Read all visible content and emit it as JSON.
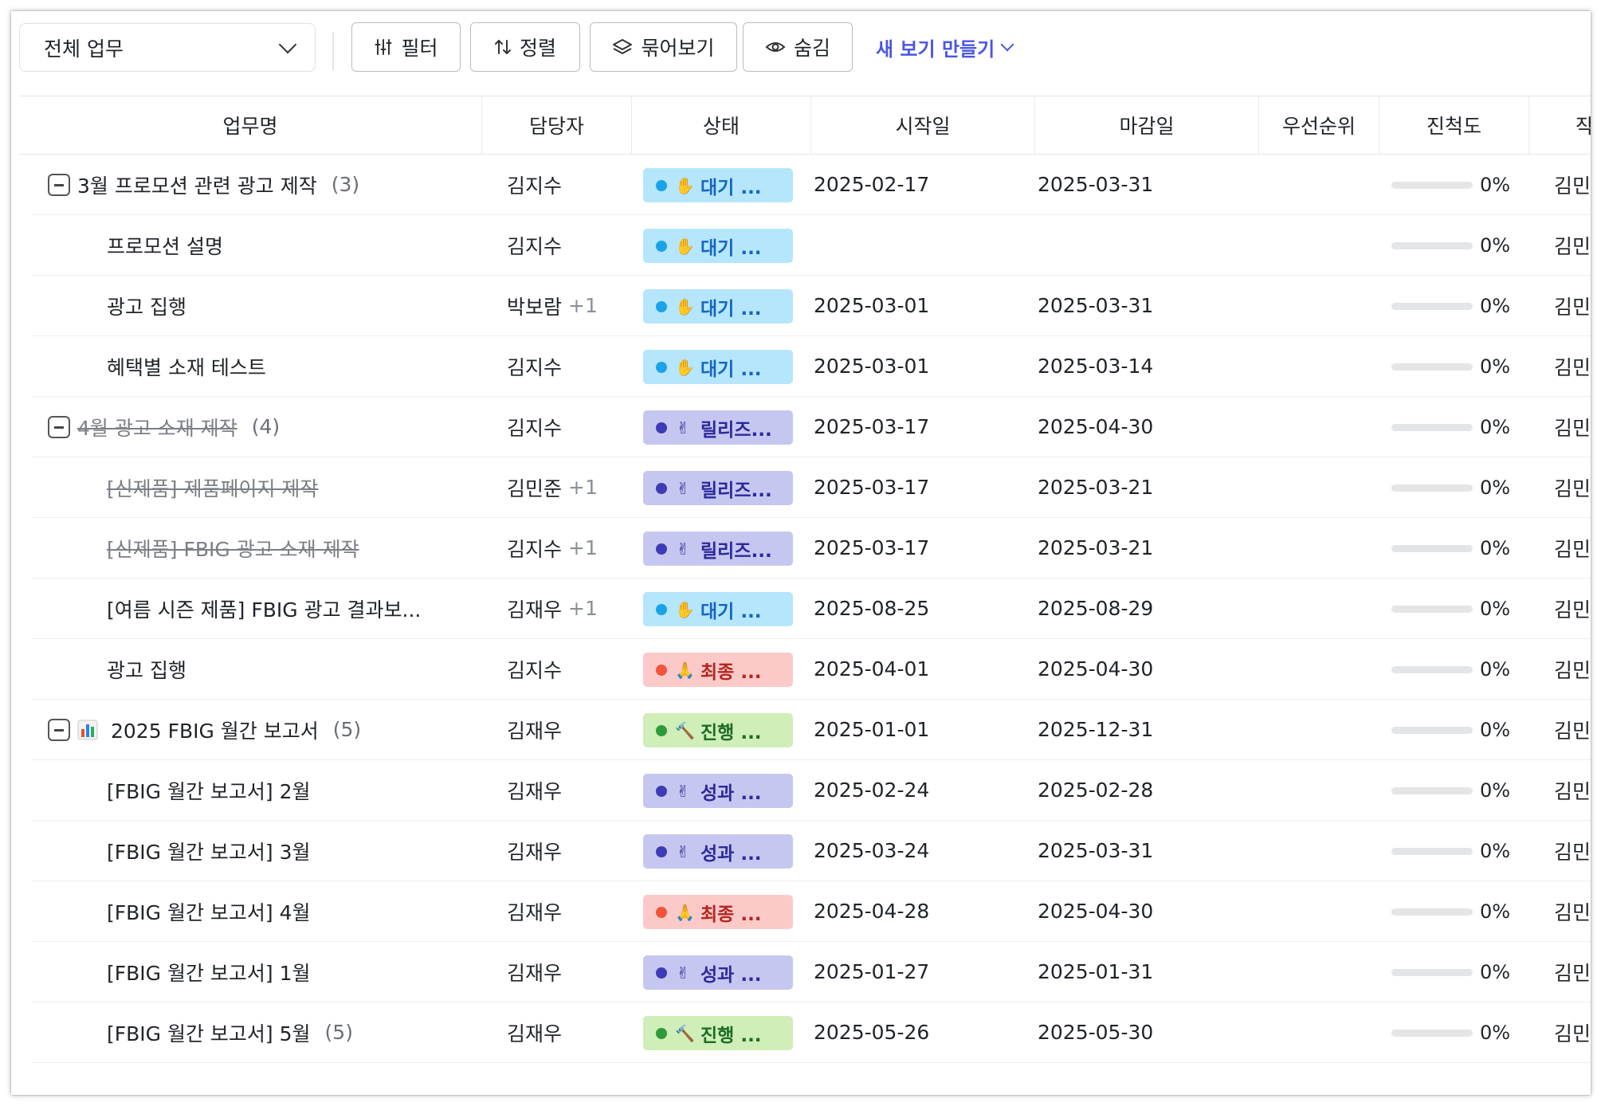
{
  "toolbar": {
    "view_select": "전체 업무",
    "filter": "필터",
    "sort": "정렬",
    "group": "묶어보기",
    "hide": "숨김",
    "new_view": "새 보기 만들기"
  },
  "columns": [
    "업무명",
    "담당자",
    "상태",
    "시작일",
    "마감일",
    "우선순위",
    "진척도",
    "작"
  ],
  "status_styles": {
    "wait": {
      "bg": "#b5e6fb",
      "dot": "#1aa3e8",
      "text": "#1565c0",
      "emoji": "✋"
    },
    "release": {
      "bg": "#c6c7f0",
      "dot": "#3d3bb5",
      "text": "#2b2a9a",
      "emoji": "✌"
    },
    "final": {
      "bg": "#fcc9c9",
      "dot": "#f0553b",
      "text": "#b3261e",
      "emoji": "🙏"
    },
    "progress": {
      "bg": "#cfeeb8",
      "dot": "#2e9a3c",
      "text": "#1e6b28",
      "emoji": "🔨"
    },
    "result": {
      "bg": "#c6c7f0",
      "dot": "#3d3bb5",
      "text": "#2b2a9a",
      "emoji": "✌"
    }
  },
  "rows": [
    {
      "group": true,
      "icon": "",
      "name": "3월 프로모션 관련 광고 제작",
      "count": "(3)",
      "strike": false,
      "assignee": "김지수",
      "assignee_extra": "",
      "status": "wait",
      "status_label": "대기 ...",
      "start": "2025-02-17",
      "due": "2025-03-31",
      "priority": "",
      "progress": 0,
      "progress_label": "0%",
      "last": "김민준"
    },
    {
      "group": false,
      "name": "프로모션 설명",
      "count": "",
      "strike": false,
      "assignee": "김지수",
      "assignee_extra": "",
      "status": "wait",
      "status_label": "대기 ...",
      "start": "",
      "due": "",
      "priority": "",
      "progress": 0,
      "progress_label": "0%",
      "last": "김민준"
    },
    {
      "group": false,
      "name": "광고 집행",
      "count": "",
      "strike": false,
      "assignee": "박보람",
      "assignee_extra": "+1",
      "status": "wait",
      "status_label": "대기 ...",
      "start": "2025-03-01",
      "due": "2025-03-31",
      "priority": "",
      "progress": 0,
      "progress_label": "0%",
      "last": "김민준"
    },
    {
      "group": false,
      "name": "혜택별 소재 테스트",
      "count": "",
      "strike": false,
      "assignee": "김지수",
      "assignee_extra": "",
      "status": "wait",
      "status_label": "대기 ...",
      "start": "2025-03-01",
      "due": "2025-03-14",
      "priority": "",
      "progress": 0,
      "progress_label": "0%",
      "last": "김민준"
    },
    {
      "group": true,
      "icon": "",
      "name": "4월 광고 소재 제작",
      "count": "(4)",
      "strike": true,
      "assignee": "김지수",
      "assignee_extra": "",
      "status": "release",
      "status_label": "릴리즈...",
      "start": "2025-03-17",
      "due": "2025-04-30",
      "priority": "",
      "progress": 0,
      "progress_label": "0%",
      "last": "김민준"
    },
    {
      "group": false,
      "name": "[신제품] 제품페이지 제작",
      "count": "",
      "strike": true,
      "assignee": "김민준",
      "assignee_extra": "+1",
      "status": "release",
      "status_label": "릴리즈...",
      "start": "2025-03-17",
      "due": "2025-03-21",
      "priority": "",
      "progress": 0,
      "progress_label": "0%",
      "last": "김민준"
    },
    {
      "group": false,
      "name": "[신제품] FBIG 광고 소재 제작",
      "count": "",
      "strike": true,
      "assignee": "김지수",
      "assignee_extra": "+1",
      "status": "release",
      "status_label": "릴리즈...",
      "start": "2025-03-17",
      "due": "2025-03-21",
      "priority": "",
      "progress": 0,
      "progress_label": "0%",
      "last": "김민준"
    },
    {
      "group": false,
      "name": "[여름 시즌 제품] FBIG 광고 결과보...",
      "count": "",
      "strike": false,
      "assignee": "김재우",
      "assignee_extra": "+1",
      "status": "wait",
      "status_label": "대기 ...",
      "start": "2025-08-25",
      "due": "2025-08-29",
      "priority": "",
      "progress": 0,
      "progress_label": "0%",
      "last": "김민준"
    },
    {
      "group": false,
      "name": "광고 집행",
      "count": "",
      "strike": false,
      "assignee": "김지수",
      "assignee_extra": "",
      "status": "final",
      "status_label": "최종 ...",
      "start": "2025-04-01",
      "due": "2025-04-30",
      "priority": "",
      "progress": 0,
      "progress_label": "0%",
      "last": "김민준"
    },
    {
      "group": true,
      "icon": "bar-chart-icon",
      "name": "2025 FBIG 월간 보고서",
      "count": "(5)",
      "strike": false,
      "assignee": "김재우",
      "assignee_extra": "",
      "status": "progress",
      "status_label": "진행 ...",
      "start": "2025-01-01",
      "due": "2025-12-31",
      "priority": "",
      "progress": 0,
      "progress_label": "0%",
      "last": "김민준"
    },
    {
      "group": false,
      "name": "[FBIG 월간 보고서] 2월",
      "count": "",
      "strike": false,
      "assignee": "김재우",
      "assignee_extra": "",
      "status": "result",
      "status_label": "성과 ...",
      "start": "2025-02-24",
      "due": "2025-02-28",
      "priority": "",
      "progress": 0,
      "progress_label": "0%",
      "last": "김민준"
    },
    {
      "group": false,
      "name": "[FBIG 월간 보고서] 3월",
      "count": "",
      "strike": false,
      "assignee": "김재우",
      "assignee_extra": "",
      "status": "result",
      "status_label": "성과 ...",
      "start": "2025-03-24",
      "due": "2025-03-31",
      "priority": "",
      "progress": 0,
      "progress_label": "0%",
      "last": "김민준"
    },
    {
      "group": false,
      "name": "[FBIG 월간 보고서] 4월",
      "count": "",
      "strike": false,
      "assignee": "김재우",
      "assignee_extra": "",
      "status": "final",
      "status_label": "최종 ...",
      "start": "2025-04-28",
      "due": "2025-04-30",
      "priority": "",
      "progress": 0,
      "progress_label": "0%",
      "last": "김민준"
    },
    {
      "group": false,
      "name": "[FBIG 월간 보고서] 1월",
      "count": "",
      "strike": false,
      "assignee": "김재우",
      "assignee_extra": "",
      "status": "result",
      "status_label": "성과 ...",
      "start": "2025-01-27",
      "due": "2025-01-31",
      "priority": "",
      "progress": 0,
      "progress_label": "0%",
      "last": "김민준"
    },
    {
      "group": false,
      "name": "[FBIG 월간 보고서] 5월",
      "count": "(5)",
      "strike": false,
      "assignee": "김재우",
      "assignee_extra": "",
      "status": "progress",
      "status_label": "진행 ...",
      "start": "2025-05-26",
      "due": "2025-05-30",
      "priority": "",
      "progress": 0,
      "progress_label": "0%",
      "last": "김민준"
    }
  ]
}
